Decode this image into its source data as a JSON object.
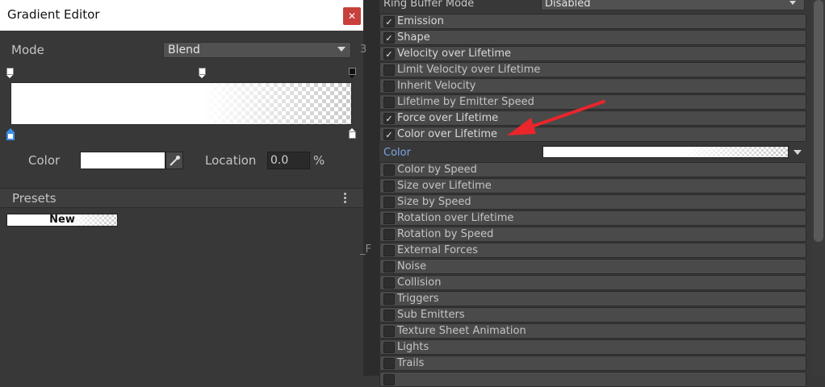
{
  "gradient_editor": {
    "title": "Gradient Editor",
    "close_glyph": "✕",
    "mode_label": "Mode",
    "mode_value": "Blend",
    "color_label": "Color",
    "color_value": "#ffffff",
    "location_label": "Location",
    "location_value": "0.0",
    "location_unit": "%",
    "presets_label": "Presets",
    "preset_name": "New"
  },
  "side_marks": {
    "top": "3",
    "middle": "_F"
  },
  "inspector": {
    "ring_buffer_label": "Ring Buffer Mode",
    "ring_buffer_value": "Disabled",
    "color_field_label": "Color",
    "modules": [
      {
        "label": "Emission",
        "checked": true
      },
      {
        "label": "Shape",
        "checked": true
      },
      {
        "label": "Velocity over Lifetime",
        "checked": true
      },
      {
        "label": "Limit Velocity over Lifetime",
        "checked": false
      },
      {
        "label": "Inherit Velocity",
        "checked": false
      },
      {
        "label": "Lifetime by Emitter Speed",
        "checked": false
      },
      {
        "label": "Force over Lifetime",
        "checked": true
      },
      {
        "label": "Color over Lifetime",
        "checked": true
      },
      {
        "label": "Color by Speed",
        "checked": false
      },
      {
        "label": "Size over Lifetime",
        "checked": false
      },
      {
        "label": "Size by Speed",
        "checked": false
      },
      {
        "label": "Rotation over Lifetime",
        "checked": false
      },
      {
        "label": "Rotation by Speed",
        "checked": false
      },
      {
        "label": "External Forces",
        "checked": false
      },
      {
        "label": "Noise",
        "checked": false
      },
      {
        "label": "Collision",
        "checked": false
      },
      {
        "label": "Triggers",
        "checked": false
      },
      {
        "label": "Sub Emitters",
        "checked": false
      },
      {
        "label": "Texture Sheet Animation",
        "checked": false
      },
      {
        "label": "Lights",
        "checked": false
      },
      {
        "label": "Trails",
        "checked": false
      },
      {
        "label": "",
        "checked": false
      }
    ],
    "check_glyph": "✓"
  },
  "colors": {
    "accent_blue": "#7aa5e8",
    "annotation_red": "#e8262b",
    "close_red": "#c8403b"
  }
}
